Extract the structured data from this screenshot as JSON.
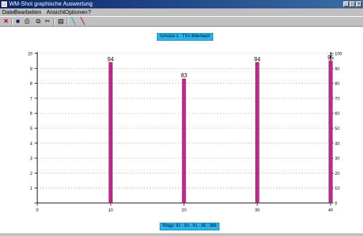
{
  "window": {
    "title": "WM-Shot graphische Auswertung",
    "buttons": [
      "_",
      "□",
      "×"
    ]
  },
  "menu": {
    "items": [
      "Datei",
      "Bearbeiten",
      "Ansicht",
      "Optionen",
      "?"
    ]
  },
  "toolbar": {
    "icons": [
      "close-icon",
      "save-icon",
      "print-icon",
      "copy-icon",
      "cut-icon",
      "table-icon",
      "pencil-icon",
      "marker-icon"
    ],
    "glyphs": [
      "✕",
      "■",
      "⎙",
      "⧉",
      "✂",
      "▤",
      "╲",
      "╲"
    ],
    "colors": {
      "close": "#c00000",
      "save": "#002080",
      "pencil": "#10a0c0",
      "marker": "#c01020"
    }
  },
  "header_badge": "Schütze 1  ·  TSV Billerbach",
  "footer_badge": "Ringe: 91 - 83 - 91 - 95 : 366",
  "chart_data": {
    "type": "bar",
    "x": [
      10,
      20,
      30,
      40
    ],
    "values": [
      94,
      83,
      94,
      95
    ],
    "labels": [
      "94",
      "83",
      "94",
      "95"
    ],
    "xlim": [
      0,
      40
    ],
    "x_ticks": [
      "0",
      "10",
      "20",
      "30",
      "40"
    ],
    "ylim_right": [
      0,
      100
    ],
    "y_ticks_right": [
      "0",
      "10",
      "20",
      "30",
      "40",
      "50",
      "60",
      "70",
      "80",
      "90",
      "100"
    ],
    "ylim_left": [
      0,
      10
    ],
    "y_ticks_left": [
      "",
      "1",
      "2",
      "3",
      "4",
      "5",
      "6",
      "7",
      "8",
      "9",
      "10"
    ],
    "grid": true,
    "bar_color": "#c0288c"
  }
}
